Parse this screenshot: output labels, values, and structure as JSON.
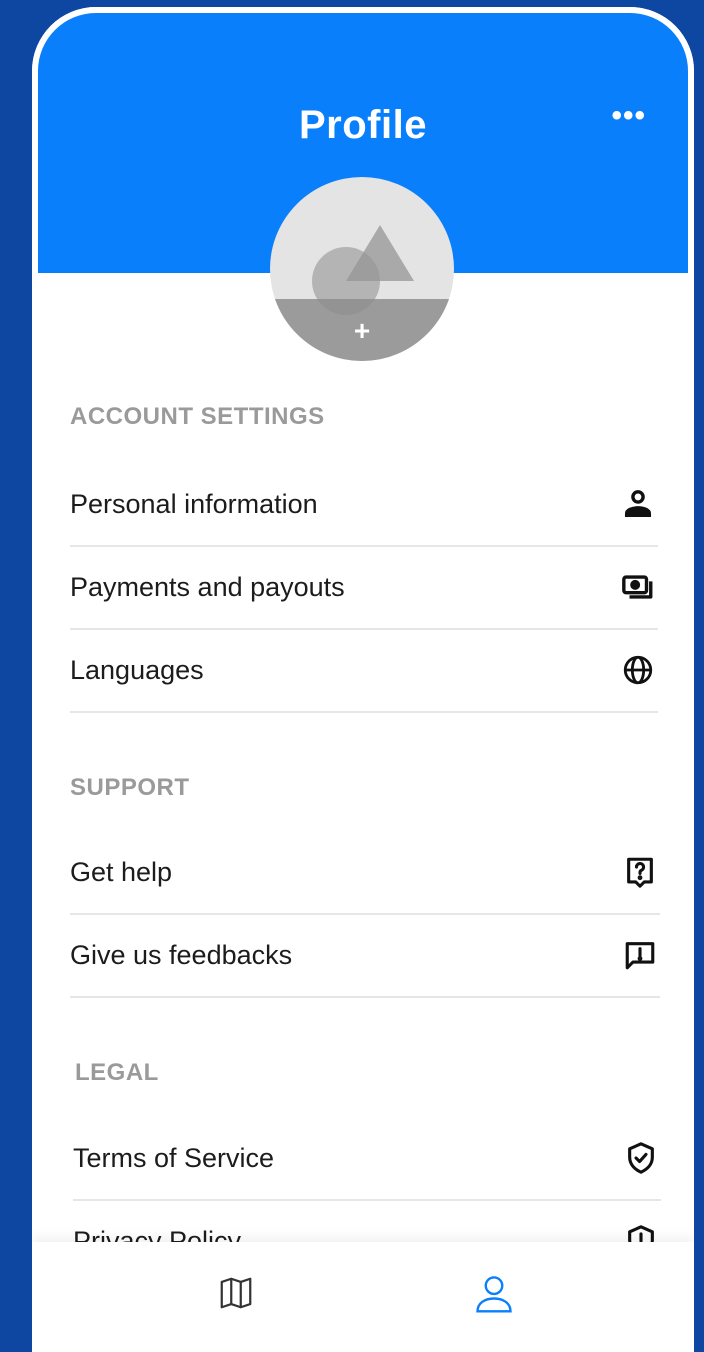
{
  "header": {
    "title": "Profile",
    "more_label": "•••"
  },
  "avatar": {
    "add_label": "+"
  },
  "sections": {
    "account": {
      "title": "ACCOUNT SETTINGS",
      "items": [
        {
          "label": "Personal information",
          "icon": "person-icon"
        },
        {
          "label": "Payments and payouts",
          "icon": "money-icon"
        },
        {
          "label": "Languages",
          "icon": "globe-icon"
        }
      ]
    },
    "support": {
      "title": "SUPPORT",
      "items": [
        {
          "label": "Get help",
          "icon": "help-icon"
        },
        {
          "label": "Give us feedbacks",
          "icon": "feedback-icon"
        }
      ]
    },
    "legal": {
      "title": "LEGAL",
      "items": [
        {
          "label": "Terms of Service",
          "icon": "shield-check-icon"
        },
        {
          "label": "Privacy Policy",
          "icon": "shield-icon"
        }
      ]
    }
  },
  "tabbar": {
    "tabs": [
      {
        "name": "map",
        "icon": "map-icon",
        "color": "#333333"
      },
      {
        "name": "profile",
        "icon": "user-icon",
        "color": "#0a7ffc",
        "active": true
      }
    ]
  },
  "colors": {
    "primary": "#0a7ffc",
    "background": "#0d47a1",
    "section_title": "#9a9a9a"
  }
}
